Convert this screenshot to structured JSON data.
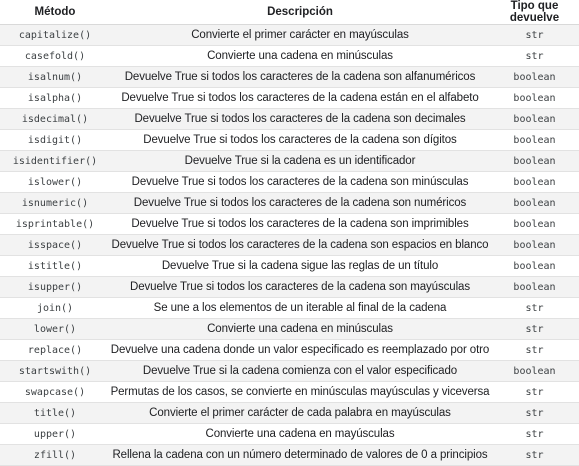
{
  "table": {
    "headers": [
      "Método",
      "Descripción",
      "Tipo que devuelve"
    ],
    "rows": [
      [
        "capitalize()",
        "Convierte el primer carácter en mayúsculas",
        "str"
      ],
      [
        "casefold()",
        "Convierte una cadena en minúsculas",
        "str"
      ],
      [
        "isalnum()",
        "Devuelve True si todos los caracteres de la cadena son alfanuméricos",
        "boolean"
      ],
      [
        "isalpha()",
        "Devuelve True si todos los caracteres de la cadena están en el alfabeto",
        "boolean"
      ],
      [
        "isdecimal()",
        "Devuelve True si todos los caracteres de la cadena son decimales",
        "boolean"
      ],
      [
        "isdigit()",
        "Devuelve True si todos los caracteres de la cadena son dígitos",
        "boolean"
      ],
      [
        "isidentifier()",
        "Devuelve True si la cadena es un identificador",
        "boolean"
      ],
      [
        "islower()",
        "Devuelve True si todos los caracteres de la cadena son minúsculas",
        "boolean"
      ],
      [
        "isnumeric()",
        "Devuelve True si todos los caracteres de la cadena son numéricos",
        "boolean"
      ],
      [
        "isprintable()",
        "Devuelve True si todos los caracteres de la cadena son imprimibles",
        "boolean"
      ],
      [
        "isspace()",
        "Devuelve True si todos los caracteres de la cadena son espacios en blanco",
        "boolean"
      ],
      [
        "istitle()",
        "Devuelve True si la cadena sigue las reglas de un título",
        "boolean"
      ],
      [
        "isupper()",
        "Devuelve True si todos los caracteres de la cadena son mayúsculas",
        "boolean"
      ],
      [
        "join()",
        "Se une a los elementos de un iterable al final de la cadena",
        "str"
      ],
      [
        "lower()",
        "Convierte una cadena en minúsculas",
        "str"
      ],
      [
        "replace()",
        "Devuelve una cadena donde un valor especificado es reemplazado por otro",
        "str"
      ],
      [
        "startswith()",
        "Devuelve True si la cadena comienza con el valor especificado",
        "boolean"
      ],
      [
        "swapcase()",
        "Permutas de los casos, se convierte en minúsculas mayúsculas y viceversa",
        "str"
      ],
      [
        "title()",
        "Convierte el primer carácter de cada palabra en mayúsculas",
        "str"
      ],
      [
        "upper()",
        "Convierte una cadena en mayúsculas",
        "str"
      ],
      [
        "zfill()",
        "Rellena la cadena con un número determinado de valores de 0 a principios",
        "str"
      ]
    ]
  }
}
